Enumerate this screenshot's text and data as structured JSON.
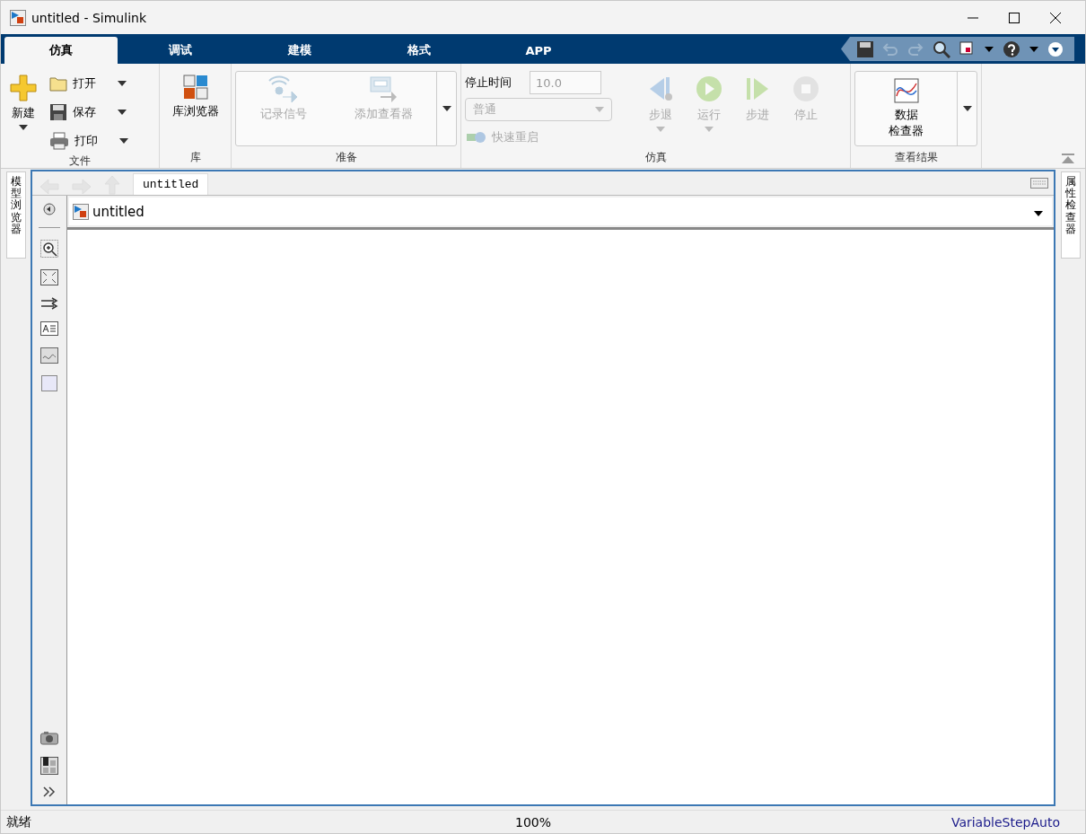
{
  "window": {
    "title": "untitled - Simulink"
  },
  "tabs": [
    {
      "label": "仿真",
      "selected": true
    },
    {
      "label": "调试",
      "selected": false
    },
    {
      "label": "建模",
      "selected": false
    },
    {
      "label": "格式",
      "selected": false
    },
    {
      "label": "APP",
      "selected": false
    }
  ],
  "ribbon": {
    "file": {
      "label": "文件",
      "new_button": "新建",
      "items": [
        {
          "kind": "open",
          "label": "打开"
        },
        {
          "kind": "save",
          "label": "保存"
        },
        {
          "kind": "print",
          "label": "打印"
        }
      ]
    },
    "library": {
      "label": "库",
      "button": "库浏览器"
    },
    "prepare": {
      "label": "准备",
      "buttons": [
        {
          "kind": "log",
          "label": "记录信号",
          "disabled": true
        },
        {
          "kind": "viewer",
          "label": "添加查看器",
          "disabled": true
        }
      ]
    },
    "simulation": {
      "label": "仿真",
      "stop_time_label": "停止时间",
      "stop_time": "10.0",
      "mode": "普通",
      "fast_restart": "快速重启",
      "disabled": true,
      "buttons": [
        {
          "kind": "step_back",
          "label": "步退",
          "has_menu": true,
          "disabled": true
        },
        {
          "kind": "run",
          "label": "运行",
          "has_menu": true,
          "disabled": true
        },
        {
          "kind": "step_forward",
          "label": "步进",
          "has_menu": false,
          "disabled": true
        },
        {
          "kind": "stop",
          "label": "停止",
          "has_menu": false,
          "disabled": true
        }
      ]
    },
    "review": {
      "label": "查看结果",
      "button_lines": [
        "数据",
        "检查器"
      ]
    }
  },
  "side_panels": {
    "left": "模型浏览器",
    "right": "属性检查器"
  },
  "editor": {
    "tab": "untitled",
    "breadcrumb": "untitled"
  },
  "status_bar": {
    "state": "就绪",
    "zoom": "100%",
    "solver": "VariableStepAuto"
  }
}
